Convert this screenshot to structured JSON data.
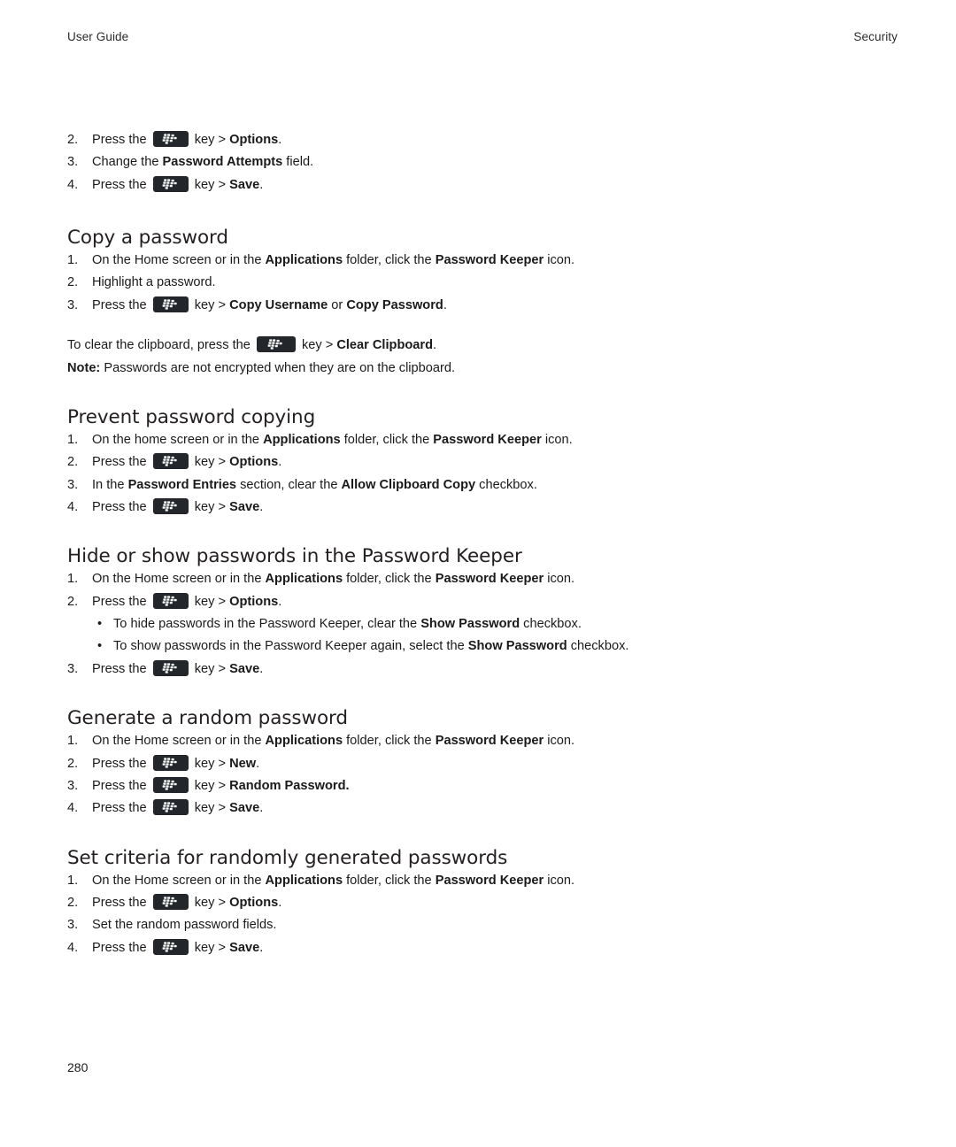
{
  "header": {
    "left": "User Guide",
    "right": "Security"
  },
  "icons": {
    "menu_key": "blackberry-menu-key-icon"
  },
  "intro_steps": [
    {
      "num": "2.",
      "parts": [
        {
          "t": "Press the ",
          "b": false
        },
        {
          "t": "__KEY__",
          "b": false
        },
        {
          "t": " key > ",
          "b": false
        },
        {
          "t": "Options",
          "b": true
        },
        {
          "t": ".",
          "b": false
        }
      ]
    },
    {
      "num": "3.",
      "parts": [
        {
          "t": "Change the ",
          "b": false
        },
        {
          "t": "Password Attempts",
          "b": true
        },
        {
          "t": " field.",
          "b": false
        }
      ]
    },
    {
      "num": "4.",
      "parts": [
        {
          "t": "Press the ",
          "b": false
        },
        {
          "t": "__KEY__",
          "b": false
        },
        {
          "t": " key > ",
          "b": false
        },
        {
          "t": "Save",
          "b": true
        },
        {
          "t": ".",
          "b": false
        }
      ]
    }
  ],
  "sections": [
    {
      "id": "copy-a-password",
      "title": "Copy a password",
      "steps": [
        {
          "num": "1.",
          "parts": [
            {
              "t": "On the Home screen or in the ",
              "b": false
            },
            {
              "t": "Applications",
              "b": true
            },
            {
              "t": " folder, click the ",
              "b": false
            },
            {
              "t": "Password Keeper",
              "b": true
            },
            {
              "t": " icon.",
              "b": false
            }
          ]
        },
        {
          "num": "2.",
          "parts": [
            {
              "t": "Highlight a password.",
              "b": false
            }
          ]
        },
        {
          "num": "3.",
          "parts": [
            {
              "t": "Press the ",
              "b": false
            },
            {
              "t": "__KEY__",
              "b": false
            },
            {
              "t": " key > ",
              "b": false
            },
            {
              "t": "Copy Username",
              "b": true
            },
            {
              "t": " or ",
              "b": false
            },
            {
              "t": "Copy Password",
              "b": true
            },
            {
              "t": ".",
              "b": false
            }
          ]
        }
      ],
      "paragraphs": [
        {
          "parts": [
            {
              "t": "To clear the clipboard, press the ",
              "b": false
            },
            {
              "t": "__KEY_WIDE__",
              "b": false
            },
            {
              "t": " key > ",
              "b": false
            },
            {
              "t": "Clear Clipboard",
              "b": true
            },
            {
              "t": ".",
              "b": false
            }
          ]
        },
        {
          "parts": [
            {
              "t": "Note:",
              "b": true
            },
            {
              "t": " Passwords are not encrypted when they are on the clipboard.",
              "b": false
            }
          ]
        }
      ]
    },
    {
      "id": "prevent-password-copying",
      "title": "Prevent password copying",
      "steps": [
        {
          "num": "1.",
          "parts": [
            {
              "t": "On the home screen or in the ",
              "b": false
            },
            {
              "t": "Applications",
              "b": true
            },
            {
              "t": " folder, click the ",
              "b": false
            },
            {
              "t": "Password Keeper",
              "b": true
            },
            {
              "t": " icon.",
              "b": false
            }
          ]
        },
        {
          "num": "2.",
          "parts": [
            {
              "t": "Press the ",
              "b": false
            },
            {
              "t": "__KEY__",
              "b": false
            },
            {
              "t": " key > ",
              "b": false
            },
            {
              "t": "Options",
              "b": true
            },
            {
              "t": ".",
              "b": false
            }
          ]
        },
        {
          "num": "3.",
          "parts": [
            {
              "t": "In the ",
              "b": false
            },
            {
              "t": "Password Entries",
              "b": true
            },
            {
              "t": " section, clear the ",
              "b": false
            },
            {
              "t": "Allow Clipboard Copy",
              "b": true
            },
            {
              "t": " checkbox.",
              "b": false
            }
          ]
        },
        {
          "num": "4.",
          "parts": [
            {
              "t": "Press the ",
              "b": false
            },
            {
              "t": "__KEY__",
              "b": false
            },
            {
              "t": " key > ",
              "b": false
            },
            {
              "t": "Save",
              "b": true
            },
            {
              "t": ".",
              "b": false
            }
          ]
        }
      ],
      "paragraphs": []
    },
    {
      "id": "hide-or-show-passwords",
      "title": "Hide or show passwords in the Password Keeper",
      "steps": [
        {
          "num": "1.",
          "parts": [
            {
              "t": "On the Home screen or in the ",
              "b": false
            },
            {
              "t": "Applications",
              "b": true
            },
            {
              "t": " folder, click the ",
              "b": false
            },
            {
              "t": "Password Keeper",
              "b": true
            },
            {
              "t": " icon.",
              "b": false
            }
          ]
        },
        {
          "num": "2.",
          "parts": [
            {
              "t": "Press the ",
              "b": false
            },
            {
              "t": "__KEY__",
              "b": false
            },
            {
              "t": " key > ",
              "b": false
            },
            {
              "t": "Options",
              "b": true
            },
            {
              "t": ".",
              "b": false
            }
          ]
        }
      ],
      "bullets": [
        {
          "parts": [
            {
              "t": "To hide passwords in the Password Keeper, clear the ",
              "b": false
            },
            {
              "t": "Show Password",
              "b": true
            },
            {
              "t": " checkbox.",
              "b": false
            }
          ]
        },
        {
          "parts": [
            {
              "t": "To show passwords in the Password Keeper again, select the ",
              "b": false
            },
            {
              "t": "Show Password",
              "b": true
            },
            {
              "t": " checkbox.",
              "b": false
            }
          ]
        }
      ],
      "steps_after": [
        {
          "num": "3.",
          "parts": [
            {
              "t": "Press the ",
              "b": false
            },
            {
              "t": "__KEY__",
              "b": false
            },
            {
              "t": " key > ",
              "b": false
            },
            {
              "t": "Save",
              "b": true
            },
            {
              "t": ".",
              "b": false
            }
          ]
        }
      ],
      "paragraphs": []
    },
    {
      "id": "generate-a-random-password",
      "title": "Generate a random password",
      "steps": [
        {
          "num": "1.",
          "parts": [
            {
              "t": "On the Home screen or in the ",
              "b": false
            },
            {
              "t": "Applications",
              "b": true
            },
            {
              "t": " folder, click the ",
              "b": false
            },
            {
              "t": "Password Keeper",
              "b": true
            },
            {
              "t": " icon.",
              "b": false
            }
          ]
        },
        {
          "num": "2.",
          "parts": [
            {
              "t": "Press the ",
              "b": false
            },
            {
              "t": "__KEY__",
              "b": false
            },
            {
              "t": " key > ",
              "b": false
            },
            {
              "t": "New",
              "b": true
            },
            {
              "t": ".",
              "b": false
            }
          ]
        },
        {
          "num": "3.",
          "parts": [
            {
              "t": "Press the ",
              "b": false
            },
            {
              "t": "__KEY__",
              "b": false
            },
            {
              "t": " key > ",
              "b": false
            },
            {
              "t": "Random Password.",
              "b": true
            }
          ]
        },
        {
          "num": "4.",
          "parts": [
            {
              "t": "Press the ",
              "b": false
            },
            {
              "t": "__KEY__",
              "b": false
            },
            {
              "t": " key > ",
              "b": false
            },
            {
              "t": "Save",
              "b": true
            },
            {
              "t": ".",
              "b": false
            }
          ]
        }
      ],
      "paragraphs": []
    },
    {
      "id": "set-criteria-random-passwords",
      "title": "Set criteria for randomly generated passwords",
      "steps": [
        {
          "num": "1.",
          "parts": [
            {
              "t": "On the Home screen or in the ",
              "b": false
            },
            {
              "t": "Applications",
              "b": true
            },
            {
              "t": " folder, click the ",
              "b": false
            },
            {
              "t": "Password Keeper",
              "b": true
            },
            {
              "t": " icon.",
              "b": false
            }
          ]
        },
        {
          "num": "2.",
          "parts": [
            {
              "t": "Press the ",
              "b": false
            },
            {
              "t": "__KEY__",
              "b": false
            },
            {
              "t": " key > ",
              "b": false
            },
            {
              "t": "Options",
              "b": true
            },
            {
              "t": ".",
              "b": false
            }
          ]
        },
        {
          "num": "3.",
          "parts": [
            {
              "t": "Set the random password fields.",
              "b": false
            }
          ]
        },
        {
          "num": "4.",
          "parts": [
            {
              "t": "Press the ",
              "b": false
            },
            {
              "t": "__KEY__",
              "b": false
            },
            {
              "t": " key > ",
              "b": false
            },
            {
              "t": "Save",
              "b": true
            },
            {
              "t": ".",
              "b": false
            }
          ]
        }
      ],
      "paragraphs": []
    }
  ],
  "footer": {
    "page_number": "280"
  }
}
